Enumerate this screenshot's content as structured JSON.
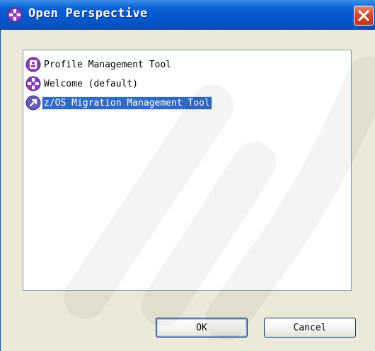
{
  "window": {
    "title": "Open Perspective",
    "title_icon": "perspective-icon",
    "close_icon": "close-icon"
  },
  "perspectives": [
    {
      "label": "Profile Management Tool",
      "icon": "profile-tool-icon",
      "selected": false
    },
    {
      "label": "Welcome (default)",
      "icon": "perspective-icon",
      "selected": false
    },
    {
      "label": "z/OS Migration Management Tool",
      "icon": "migration-tool-icon",
      "selected": true
    }
  ],
  "buttons": {
    "ok_label": "OK",
    "cancel_label": "Cancel"
  },
  "colors": {
    "titlebar": "#0555cc",
    "selection": "#316ac5",
    "icon_purple": "#8b3fb8",
    "close": "#d2472a"
  }
}
